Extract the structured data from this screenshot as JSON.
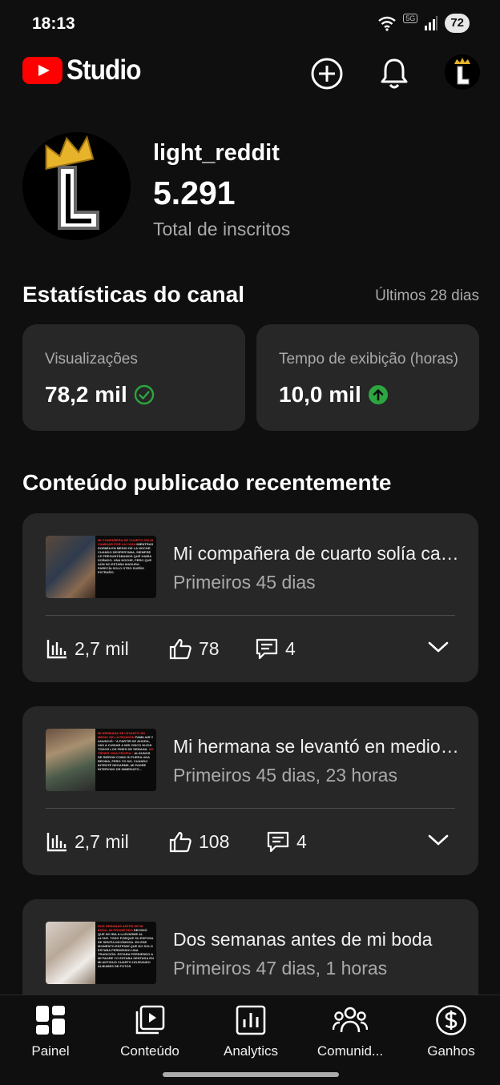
{
  "status_bar": {
    "time": "18:13",
    "network": "5G",
    "battery": "72"
  },
  "app_bar": {
    "logo_text": "Studio"
  },
  "channel": {
    "name": "light_reddit",
    "subscribers": "5.291",
    "subscribers_label": "Total de inscritos"
  },
  "stats": {
    "title": "Estatísticas do canal",
    "period": "Últimos 28 dias",
    "cards": [
      {
        "label": "Visualizações",
        "value": "78,2 mil",
        "indicator": "check-circle-icon",
        "indicator_color": "#2ba640"
      },
      {
        "label": "Tempo de exibição (horas)",
        "value": "10,0 mil",
        "indicator": "arrow-up-circle-icon",
        "indicator_color": "#2ba640"
      }
    ]
  },
  "recent": {
    "title": "Conteúdo publicado recentemente",
    "videos": [
      {
        "title": "Mi compañera de cuarto solía caminar por la casa mientras dormía",
        "period": "Primeiros 45 dias",
        "views": "2,7 mil",
        "likes": "78",
        "comments": "4"
      },
      {
        "title": "Mi hermana se levantó en medio de la reunión",
        "period": "Primeiros 45 dias, 23 horas",
        "views": "2,7 mil",
        "likes": "108",
        "comments": "4"
      },
      {
        "title": "Dos semanas antes de mi boda",
        "period": "Primeiros 47 dias, 1 horas",
        "views": "",
        "likes": "",
        "comments": ""
      }
    ]
  },
  "bottom_nav": {
    "items": [
      {
        "label": "Painel",
        "icon": "dashboard-icon"
      },
      {
        "label": "Conteúdo",
        "icon": "content-icon"
      },
      {
        "label": "Analytics",
        "icon": "analytics-icon"
      },
      {
        "label": "Comunid...",
        "icon": "community-icon"
      },
      {
        "label": "Ganhos",
        "icon": "earnings-icon"
      }
    ]
  },
  "colors": {
    "background": "#0f0f0f",
    "card": "#272727",
    "youtube_red": "#ff0000",
    "positive": "#2ba640"
  }
}
